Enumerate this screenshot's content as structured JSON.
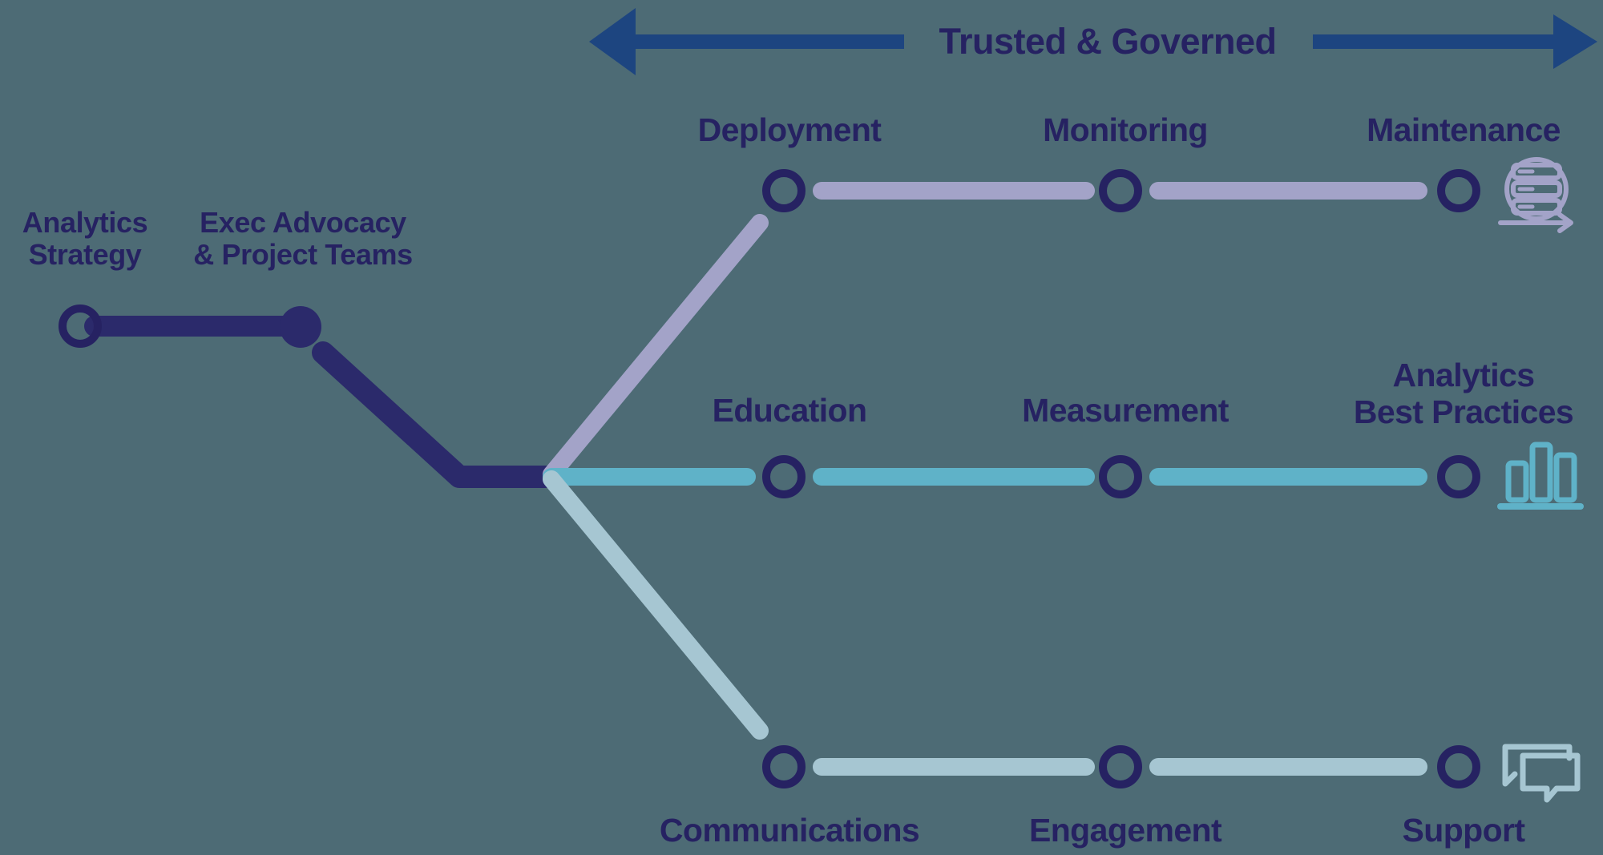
{
  "diagram": {
    "title": "Trusted & Governed",
    "background_color": "#4d6b75",
    "text_color": "#262262",
    "banner": {
      "label": "Trusted & Governed",
      "arrow_color": "#1d4580",
      "left_arrow_name": "left-arrow",
      "right_arrow_name": "right-arrow"
    },
    "stem": {
      "color": "#2b2a6b",
      "nodes": [
        {
          "label": "Analytics\nStrategy",
          "style": "outline"
        },
        {
          "label": "Exec Advocacy\n& Project Teams",
          "style": "filled"
        }
      ]
    },
    "branches": [
      {
        "id": "deployment",
        "color": "#a3a3c8",
        "label_position": "above",
        "end_icon": "database-refresh-icon",
        "steps": [
          {
            "label": "Deployment"
          },
          {
            "label": "Monitoring"
          },
          {
            "label": "Maintenance"
          }
        ]
      },
      {
        "id": "education",
        "color": "#5fb2c8",
        "label_position": "above",
        "end_icon": "bar-chart-icon",
        "steps": [
          {
            "label": "Education"
          },
          {
            "label": "Measurement"
          },
          {
            "label": "Analytics\nBest Practices"
          }
        ]
      },
      {
        "id": "communications",
        "color": "#a6c6d2",
        "label_position": "below",
        "end_icon": "speech-bubbles-icon",
        "steps": [
          {
            "label": "Communications"
          },
          {
            "label": "Engagement"
          },
          {
            "label": "Support"
          }
        ]
      }
    ]
  }
}
